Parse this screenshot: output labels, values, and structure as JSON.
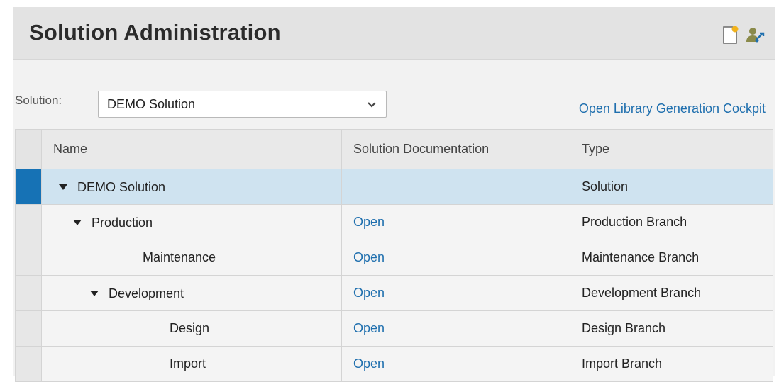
{
  "header": {
    "title": "Solution Administration",
    "icons": [
      "new-document-icon",
      "user-settings-icon"
    ]
  },
  "solution_picker": {
    "label": "Solution:",
    "selected": "DEMO Solution",
    "icon": "chevron-down-icon"
  },
  "link": {
    "label": "Open Library Generation Cockpit"
  },
  "table": {
    "columns": [
      "Name",
      "Solution Documentation",
      "Type"
    ],
    "rows": [
      {
        "name": "DEMO Solution",
        "doc": "",
        "type": "Solution",
        "level": 0,
        "expanded": true,
        "selected": true
      },
      {
        "name": "Production",
        "doc": "Open",
        "type": "Production Branch",
        "level": 1,
        "expanded": true,
        "selected": false
      },
      {
        "name": "Maintenance",
        "doc": "Open",
        "type": "Maintenance Branch",
        "level": 2,
        "expanded": false,
        "selected": false
      },
      {
        "name": "Development",
        "doc": "Open",
        "type": "Development Branch",
        "level": 2,
        "expanded": true,
        "selected": false
      },
      {
        "name": "Design",
        "doc": "Open",
        "type": "Design Branch",
        "level": 3,
        "expanded": false,
        "selected": false
      },
      {
        "name": "Import",
        "doc": "Open",
        "type": "Import Branch",
        "level": 3,
        "expanded": false,
        "selected": false
      }
    ]
  },
  "colors": {
    "link": "#1f6fae",
    "selection_marker": "#1672b5",
    "selected_row": "#cfe3f0"
  }
}
